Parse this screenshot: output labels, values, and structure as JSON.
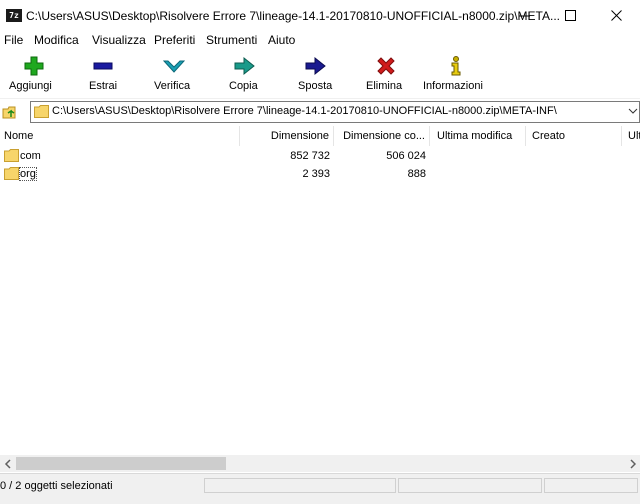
{
  "window": {
    "app_icon_text": "7z",
    "title": "C:\\Users\\ASUS\\Desktop\\Risolvere Errore 7\\lineage-14.1-20170810-UNOFFICIAL-n8000.zip\\META...",
    "controls": [
      "minimize-icon",
      "maximize-icon",
      "close-icon"
    ]
  },
  "menu": {
    "items": [
      "File",
      "Modifica",
      "Visualizza",
      "Preferiti",
      "Strumenti",
      "Aiuto"
    ]
  },
  "toolbar": {
    "buttons": [
      {
        "label": "Aggiungi",
        "icon": "plus-icon",
        "color": "#1fa81f"
      },
      {
        "label": "Estrai",
        "icon": "minus-icon",
        "color": "#1a1aa0"
      },
      {
        "label": "Verifica",
        "icon": "check-icon",
        "color": "#1aa0b4"
      },
      {
        "label": "Copia",
        "icon": "copy-arrow-icon",
        "color": "#1a9a8a"
      },
      {
        "label": "Sposta",
        "icon": "move-arrow-icon",
        "color": "#1a1a90"
      },
      {
        "label": "Elimina",
        "icon": "delete-icon",
        "color": "#d01c1c"
      },
      {
        "label": "Informazioni",
        "icon": "info-icon",
        "color": "#c8b000"
      }
    ]
  },
  "address": {
    "path": "C:\\Users\\ASUS\\Desktop\\Risolvere Errore 7\\lineage-14.1-20170810-UNOFFICIAL-n8000.zip\\META-INF\\"
  },
  "columns": [
    "Nome",
    "Dimensione",
    "Dimensione co...",
    "Ultima modifica",
    "Creato",
    "Ult"
  ],
  "files": [
    {
      "name": "com",
      "size": "852 732",
      "packed": "506 024",
      "modified": "",
      "created": ""
    },
    {
      "name": "org",
      "size": "2 393",
      "packed": "888",
      "modified": "",
      "created": ""
    }
  ],
  "status": {
    "selected": "0 / 2 oggetti selezionati"
  },
  "colors": {
    "folder": "#f7d56a",
    "chrome": "#f0f0f0"
  }
}
